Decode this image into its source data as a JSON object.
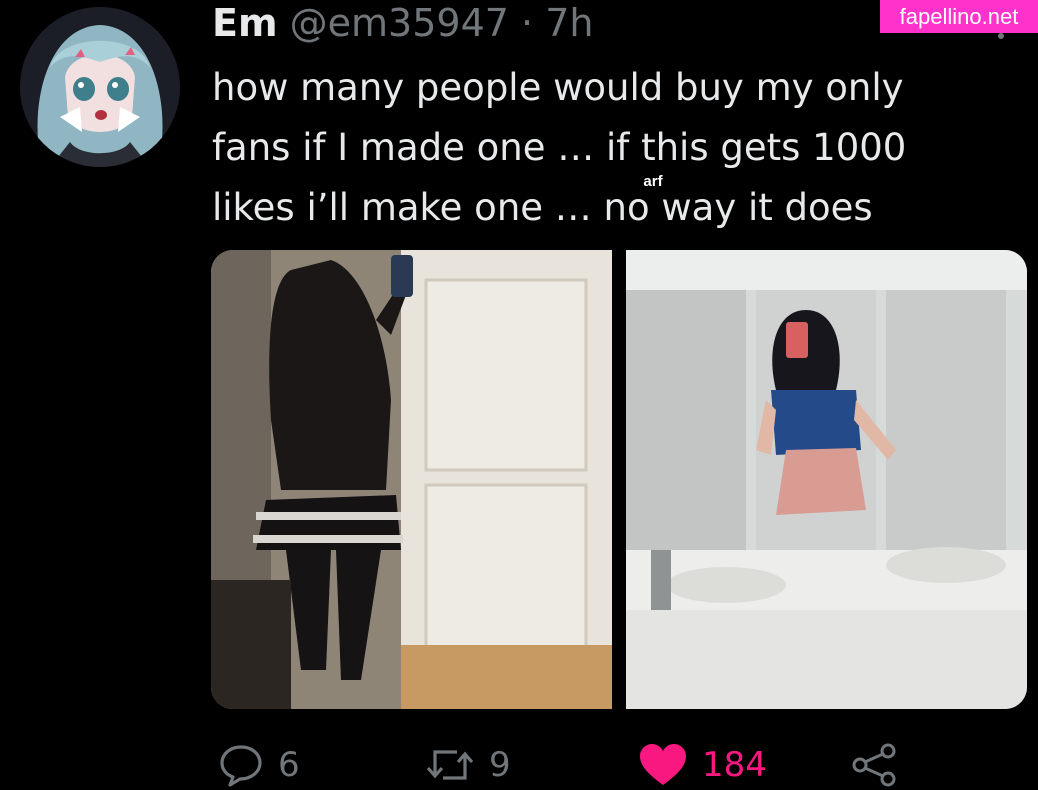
{
  "watermark": "fapellino.net",
  "tweet": {
    "author_name": "Em",
    "author_handle": "@em35947",
    "separator": "·",
    "time": "7h",
    "text": "how many people would buy my only\nfans if I made one … if this gets 1000\nlikes i’ll make one … no way it does"
  },
  "media": {
    "sticker_text": "arf"
  },
  "actions": {
    "reply_count": "6",
    "retweet_count": "9",
    "like_count": "184"
  },
  "colors": {
    "background": "#000000",
    "text_primary": "#e7e9ea",
    "text_secondary": "#71767b",
    "like_active": "#f91880",
    "watermark_bg": "#ff33cc"
  },
  "icons": {
    "reply": "reply-icon",
    "retweet": "retweet-icon",
    "like": "heart-icon",
    "share": "share-icon",
    "more": "more-icon"
  }
}
